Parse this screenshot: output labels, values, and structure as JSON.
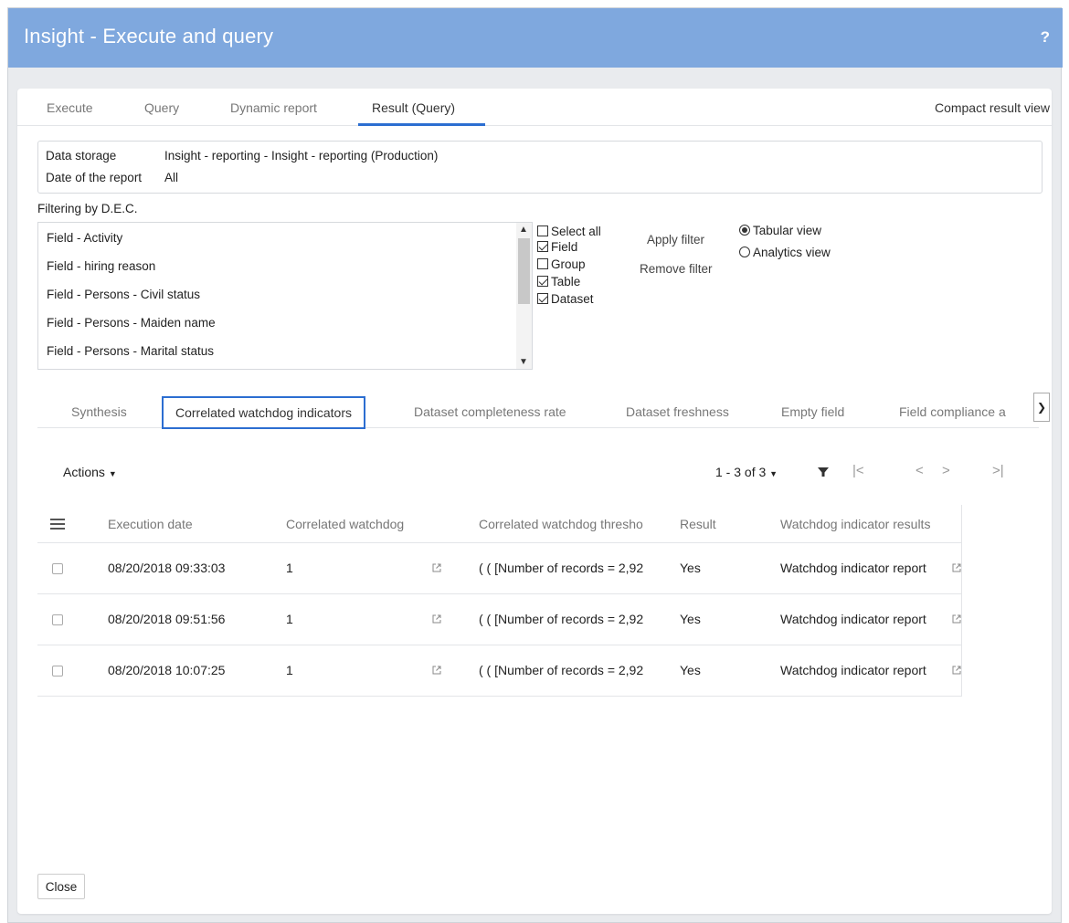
{
  "window": {
    "title": "Insight - Execute and query",
    "help_label": "?"
  },
  "main_tabs": [
    {
      "label": "Execute"
    },
    {
      "label": "Query"
    },
    {
      "label": "Dynamic report"
    },
    {
      "label": "Result (Query)",
      "active": true
    }
  ],
  "compact_view_label": "Compact result view",
  "info": {
    "data_storage_label": "Data storage",
    "data_storage_value": "Insight - reporting - Insight - reporting (Production)",
    "date_label": "Date of the report",
    "date_value": "All"
  },
  "filter": {
    "label": "Filtering by D.E.C.",
    "items": [
      "Field - Activity",
      "Field - hiring reason",
      "Field - Persons - Civil status",
      "Field - Persons - Maiden name",
      "Field - Persons - Marital status"
    ],
    "checkboxes": [
      {
        "label": "Select all",
        "checked": false
      },
      {
        "label": "Field",
        "checked": true
      },
      {
        "label": "Group",
        "checked": false
      },
      {
        "label": "Table",
        "checked": true
      },
      {
        "label": "Dataset",
        "checked": true
      }
    ],
    "apply_label": "Apply filter",
    "remove_label": "Remove filter",
    "views": [
      {
        "label": "Tabular view",
        "selected": true
      },
      {
        "label": "Analytics view",
        "selected": false
      }
    ]
  },
  "sub_tabs": [
    {
      "label": "Synthesis"
    },
    {
      "label": "Correlated watchdog indicators",
      "active": true
    },
    {
      "label": "Dataset completeness rate"
    },
    {
      "label": "Dataset freshness"
    },
    {
      "label": "Empty field"
    },
    {
      "label": "Field compliance a"
    }
  ],
  "toolbar": {
    "actions_label": "Actions",
    "pager_label": "1 - 3 of 3",
    "icons": [
      "menu-icon",
      "filter-icon",
      "first-page-icon",
      "prev-page-icon",
      "next-page-icon",
      "last-page-icon",
      "external-link-icon"
    ]
  },
  "grid": {
    "columns": [
      "Execution date",
      "Correlated watchdog",
      "Correlated watchdog thresho",
      "Result",
      "Watchdog indicator results"
    ],
    "rows": [
      {
        "date": "08/20/2018 09:33:03",
        "watchdog": "1",
        "threshold": "( ( [Number of records = 2,92",
        "result": "Yes",
        "report": "Watchdog indicator report"
      },
      {
        "date": "08/20/2018 09:51:56",
        "watchdog": "1",
        "threshold": "( ( [Number of records = 2,92",
        "result": "Yes",
        "report": "Watchdog indicator report"
      },
      {
        "date": "08/20/2018 10:07:25",
        "watchdog": "1",
        "threshold": "( ( [Number of records = 2,92",
        "result": "Yes",
        "report": "Watchdog indicator report"
      }
    ]
  },
  "close_label": "Close",
  "colors": {
    "title_bar": "#7fa8de",
    "accent": "#2c6ed1",
    "background": "#e9ebee"
  }
}
